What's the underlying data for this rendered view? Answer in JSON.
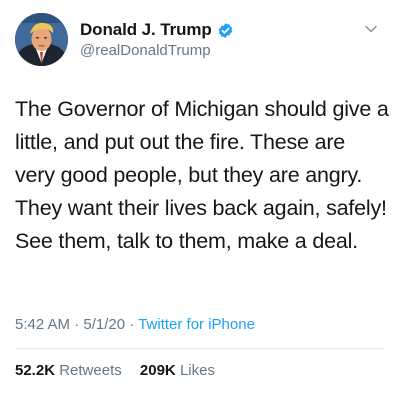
{
  "author": {
    "display_name": "Donald J. Trump",
    "handle": "@realDonaldTrump",
    "verified": true,
    "avatar_icon": "profile-photo"
  },
  "tweet": {
    "text": "The Governor of Michigan should give a little, and put out the fire. These are very good people, but they are angry. They want their lives back again, safely! See them, talk to them, make a deal."
  },
  "meta": {
    "time": "5:42 AM",
    "separator": "·",
    "date": "5/1/20",
    "source": "Twitter for iPhone"
  },
  "stats": {
    "retweets_count": "52.2K",
    "retweets_label": "Retweets",
    "likes_count": "209K",
    "likes_label": "Likes"
  },
  "colors": {
    "link": "#1da1f2",
    "secondary_text": "#657786",
    "primary_text": "#14171a"
  }
}
